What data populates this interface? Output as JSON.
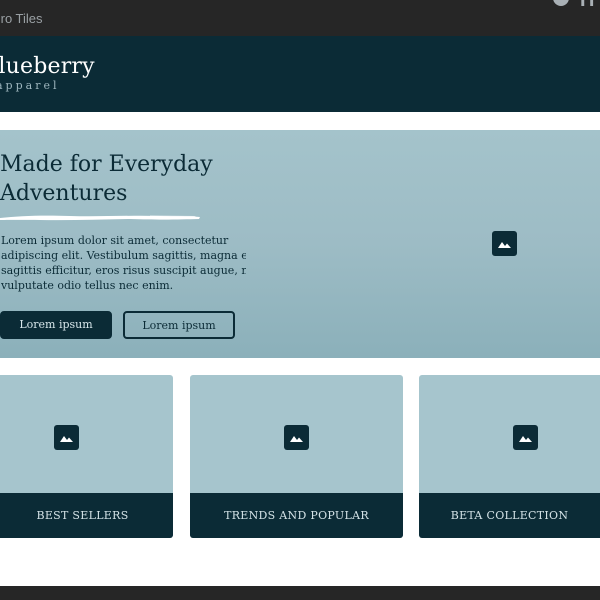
{
  "window": {
    "title": "Hero Tiles",
    "partial_h": "H"
  },
  "header": {
    "logo_name": "Blueberry",
    "logo_tagline": "apparel"
  },
  "hero": {
    "title_line1": "Made for Everyday",
    "title_line2": "Adventures",
    "body_lines": [
      "Lorem ipsum dolor sit amet, consectetur",
      "adipiscing elit. Vestibulum sagittis, magna eu",
      "sagittis efficitur, eros risus suscipit augue, nec",
      "vulputate odio tellus nec enim."
    ],
    "primary_button": "Lorem ipsum",
    "secondary_button": "Lorem ipsum",
    "image_icon": "image-placeholder-icon"
  },
  "tiles": [
    {
      "label": "BEST SELLERS",
      "icon": "image-placeholder-icon"
    },
    {
      "label": "TRENDS AND POPULAR",
      "icon": "image-placeholder-icon"
    },
    {
      "label": "BETA COLLECTION",
      "icon": "image-placeholder-icon"
    }
  ],
  "colors": {
    "dark_teal": "#0b2b36",
    "hero_bg": "#9dbcc5",
    "tile_bg": "#a6c5cd",
    "chrome": "#262626"
  }
}
